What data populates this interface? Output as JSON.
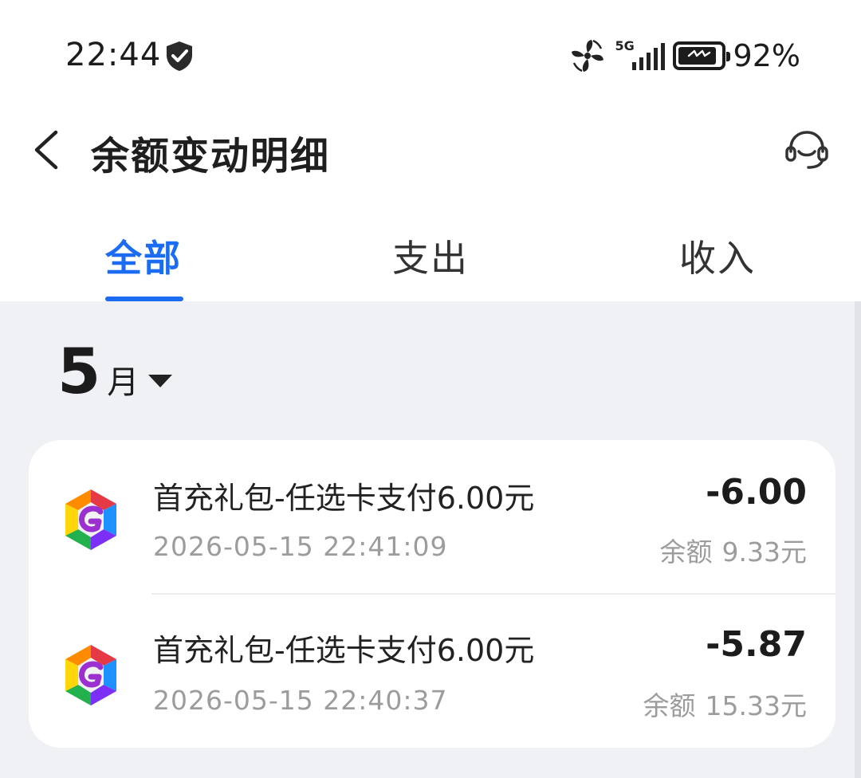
{
  "status_bar": {
    "time": "22:44",
    "network": "5G",
    "battery_percent": "92%",
    "battery_level": 0.92
  },
  "header": {
    "title": "余额变动明细"
  },
  "tabs": [
    {
      "label": "全部",
      "active": true
    },
    {
      "label": "支出",
      "active": false
    },
    {
      "label": "收入",
      "active": false
    }
  ],
  "month": {
    "number": "5",
    "unit": "月"
  },
  "transactions": [
    {
      "title": "首充礼包-任选卡支付6.00元",
      "datetime": "2026-05-15 22:41:09",
      "amount": "-6.00",
      "balance_label": "余额",
      "balance_value": "9.33元"
    },
    {
      "title": "首充礼包-任选卡支付6.00元",
      "datetime": "2026-05-15 22:40:37",
      "amount": "-5.87",
      "balance_label": "余额",
      "balance_value": "15.33元"
    }
  ],
  "colors": {
    "accent": "#1b6cf2",
    "page_bg": "#f0f1f5",
    "card_bg": "#ffffff",
    "muted_text": "#9c9c9c"
  },
  "icons": {
    "status": [
      "shield-icon",
      "fan-icon",
      "signal-icon",
      "battery-icon"
    ],
    "header": [
      "back-arrow-icon",
      "customer-service-icon"
    ],
    "month": "caret-down-icon",
    "transaction": "app-logo-icon"
  }
}
